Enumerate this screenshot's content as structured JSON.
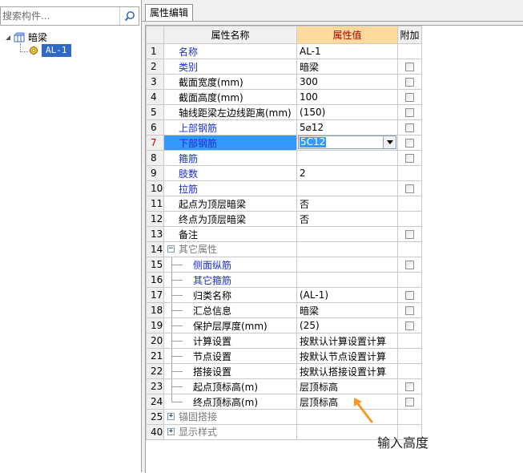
{
  "search": {
    "placeholder": "搜索构件..."
  },
  "tree": {
    "root_label": "暗梁",
    "child_label": "AL-1"
  },
  "tab": {
    "label": "属性编辑"
  },
  "columns": {
    "name": "属性名称",
    "value": "属性值",
    "add": "附加"
  },
  "rows": [
    {
      "num": "1",
      "name": "名称",
      "value": "AL-1",
      "checkbox": false,
      "style": "blue"
    },
    {
      "num": "2",
      "name": "类别",
      "value": "暗梁",
      "checkbox": true,
      "style": "blue"
    },
    {
      "num": "3",
      "name": "截面宽度(mm)",
      "value": "300",
      "checkbox": true,
      "style": "normal"
    },
    {
      "num": "4",
      "name": "截面高度(mm)",
      "value": "100",
      "checkbox": true,
      "style": "normal"
    },
    {
      "num": "5",
      "name": "轴线距梁左边线距离(mm)",
      "value": "(150)",
      "checkbox": true,
      "style": "normal"
    },
    {
      "num": "6",
      "name": "上部钢筋",
      "value": "5⌀12",
      "checkbox": true,
      "style": "blue"
    },
    {
      "num": "7",
      "name": "下部钢筋",
      "value": "5C12",
      "checkbox": true,
      "style": "blue"
    },
    {
      "num": "8",
      "name": "箍筋",
      "value": "",
      "checkbox": true,
      "style": "blue"
    },
    {
      "num": "9",
      "name": "肢数",
      "value": "2",
      "checkbox": false,
      "style": "blue"
    },
    {
      "num": "10",
      "name": "拉筋",
      "value": "",
      "checkbox": true,
      "style": "blue"
    },
    {
      "num": "11",
      "name": "起点为顶层暗梁",
      "value": "否",
      "checkbox": false,
      "style": "normal"
    },
    {
      "num": "12",
      "name": "终点为顶层暗梁",
      "value": "否",
      "checkbox": false,
      "style": "normal"
    },
    {
      "num": "13",
      "name": "备注",
      "value": "",
      "checkbox": true,
      "style": "normal"
    },
    {
      "num": "14",
      "name": "其它属性",
      "value": "",
      "checkbox": false,
      "style": "group-open"
    },
    {
      "num": "15",
      "name": "侧面纵筋",
      "value": "",
      "checkbox": true,
      "style": "child-blue"
    },
    {
      "num": "16",
      "name": "其它箍筋",
      "value": "",
      "checkbox": false,
      "style": "child-blue"
    },
    {
      "num": "17",
      "name": "归类名称",
      "value": "(AL-1)",
      "checkbox": true,
      "style": "child"
    },
    {
      "num": "18",
      "name": "汇总信息",
      "value": "暗梁",
      "checkbox": true,
      "style": "child"
    },
    {
      "num": "19",
      "name": "保护层厚度(mm)",
      "value": "(25)",
      "checkbox": true,
      "style": "child"
    },
    {
      "num": "20",
      "name": "计算设置",
      "value": "按默认计算设置计算",
      "checkbox": false,
      "style": "child"
    },
    {
      "num": "21",
      "name": "节点设置",
      "value": "按默认节点设置计算",
      "checkbox": false,
      "style": "child"
    },
    {
      "num": "22",
      "name": "搭接设置",
      "value": "按默认搭接设置计算",
      "checkbox": false,
      "style": "child"
    },
    {
      "num": "23",
      "name": "起点顶标高(m)",
      "value": "层顶标高",
      "checkbox": true,
      "style": "child"
    },
    {
      "num": "24",
      "name": "终点顶标高(m)",
      "value": "层顶标高",
      "checkbox": true,
      "style": "child-last"
    },
    {
      "num": "25",
      "name": "锚固搭接",
      "value": "",
      "checkbox": false,
      "style": "group-closed"
    },
    {
      "num": "40",
      "name": "显示样式",
      "value": "",
      "checkbox": false,
      "style": "group-closed"
    }
  ],
  "selected_row": "7",
  "annotation": {
    "text": "输入高度",
    "color": "#f39a2b"
  },
  "colors": {
    "selection": "#3399ff",
    "value_header_bg": "#fcd99c",
    "value_header_fg": "#b00000",
    "label_blue": "#1c2fc7"
  }
}
